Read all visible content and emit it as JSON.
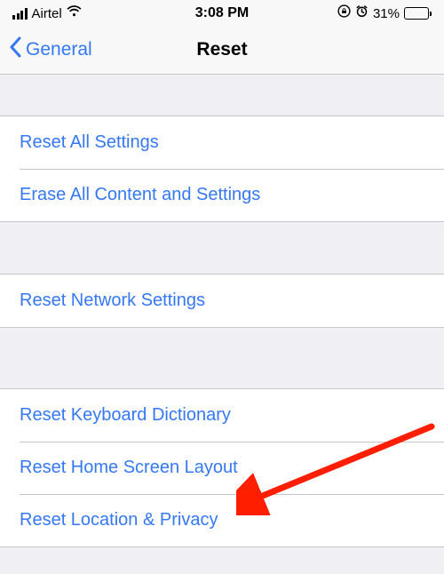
{
  "status": {
    "carrier": "Airtel",
    "time": "3:08 PM",
    "battery_percent": "31%"
  },
  "nav": {
    "back_label": "General",
    "title": "Reset"
  },
  "groups": {
    "g1": {
      "i0": "Reset All Settings",
      "i1": "Erase All Content and Settings"
    },
    "g2": {
      "i0": "Reset Network Settings"
    },
    "g3": {
      "i0": "Reset Keyboard Dictionary",
      "i1": "Reset Home Screen Layout",
      "i2": "Reset Location & Privacy"
    }
  }
}
